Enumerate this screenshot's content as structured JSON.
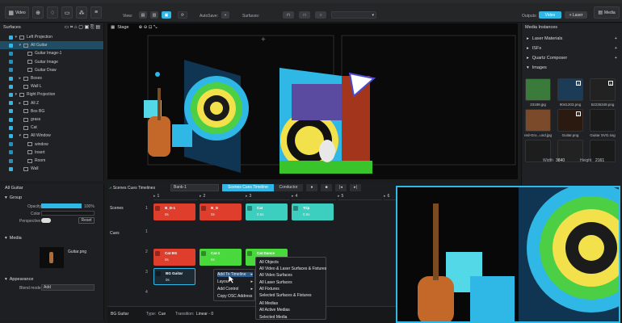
{
  "toolbar": {
    "video_label": "Video",
    "view_label": "View:",
    "autosave_label": "AutoSave:",
    "surfaces_label": "Surfaces:",
    "outputs_label": "Outputs:",
    "output_video": "Video",
    "output_laser": "+ Laser",
    "media_label": "Media"
  },
  "left": {
    "surfaces_title": "Surfaces",
    "items": [
      {
        "label": "Left Projection",
        "indent": 1,
        "arrow": "▾",
        "sel": false
      },
      {
        "label": "All Guitar",
        "indent": 2,
        "arrow": "▾",
        "sel": true
      },
      {
        "label": "Guitar Image-1",
        "indent": 3,
        "arrow": "",
        "sel": false
      },
      {
        "label": "Guitar Image",
        "indent": 3,
        "arrow": "",
        "sel": false
      },
      {
        "label": "Guitar Draw",
        "indent": 3,
        "arrow": "",
        "sel": false
      },
      {
        "label": "Boxes",
        "indent": 2,
        "arrow": "▸",
        "sel": false
      },
      {
        "label": "Wall L",
        "indent": 2,
        "arrow": "",
        "sel": false
      },
      {
        "label": "Right Projection",
        "indent": 1,
        "arrow": "▾",
        "sel": false
      },
      {
        "label": "All Z",
        "indent": 2,
        "arrow": "▸",
        "sel": false
      },
      {
        "label": "Box BG",
        "indent": 2,
        "arrow": "",
        "sel": false
      },
      {
        "label": "grass",
        "indent": 2,
        "arrow": "",
        "sel": false
      },
      {
        "label": "Cat",
        "indent": 2,
        "arrow": "",
        "sel": false
      },
      {
        "label": "All Window",
        "indent": 2,
        "arrow": "▾",
        "sel": false
      },
      {
        "label": "window",
        "indent": 3,
        "arrow": "",
        "sel": false
      },
      {
        "label": "Insert",
        "indent": 3,
        "arrow": "",
        "sel": false
      },
      {
        "label": "Room",
        "indent": 3,
        "arrow": "",
        "sel": false
      },
      {
        "label": "Wall",
        "indent": 2,
        "arrow": "",
        "sel": false
      }
    ],
    "inspector_title": "All Guitar",
    "group_label": "Group",
    "opacity_label": "Opacity",
    "opacity_value": "100%",
    "opacity": 1.0,
    "color_label": "Color",
    "perspective_label": "Perspective",
    "reset_label": "Reset",
    "media_label": "Media",
    "media_file": "Guitar.png",
    "appearance_label": "Appearance",
    "blend_label": "Blend mode",
    "blend_value": "Add"
  },
  "stage": {
    "title": "Stage"
  },
  "mediapanel": {
    "title": "Media Instances",
    "sections": [
      "Laser Materials",
      "ISFs",
      "Quartz Composer",
      "Images"
    ],
    "tiles": [
      {
        "label": "33189.jpg",
        "badge": "",
        "bg": "#3a7a3a"
      },
      {
        "label": "9041203.png",
        "badge": "1",
        "bg": "#1c3b57"
      },
      {
        "label": "52235349.png",
        "badge": "1",
        "bg": "#222"
      },
      {
        "label": "red-Gro...und.jpg",
        "badge": "",
        "bg": "#7a4a2a"
      },
      {
        "label": "Guitar.png",
        "badge": "1",
        "bg": "#2a1a10"
      },
      {
        "label": "Guitar SVG.svg",
        "badge": "",
        "bg": "#1a1a1a"
      },
      {
        "label": "",
        "badge": "",
        "bg": "#1d1d1d"
      },
      {
        "label": "",
        "badge": "",
        "bg": "#222"
      },
      {
        "label": "",
        "badge": "",
        "bg": "#1a1a1a"
      }
    ],
    "width_label": "Width",
    "width_value": "3840",
    "height_label": "Height",
    "height_value": "2161"
  },
  "cues": {
    "tab_label": "Scenes Cues Timelines",
    "bank": "Bank-1",
    "seg_active": "Scenes Cues Timeline",
    "seg_other": "Conductor",
    "col_numbers": [
      "1",
      "2",
      "3",
      "4",
      "5",
      "6"
    ],
    "scenes_label": "Scenes",
    "scene_row_num": "1",
    "cues_label": "Cues",
    "cue_rows": [
      "1",
      "2",
      "3",
      "4"
    ],
    "scene_cards": [
      {
        "name": "B_D-1",
        "sub": "0s",
        "color": "#e03e2d"
      },
      {
        "name": "B_D",
        "sub": "0s",
        "color": "#e03e2d"
      },
      {
        "name": "Cat",
        "sub": "0.5s",
        "color": "#3ccfbf"
      },
      {
        "name": "Trip",
        "sub": "0.5s",
        "color": "#3ccfbf"
      }
    ],
    "cue_cards": [
      {
        "name": "Cat BG",
        "sub": "0s",
        "color": "#e03e2d"
      },
      {
        "name": "Cat-1",
        "sub": "0s",
        "color": "#49d93c"
      },
      {
        "name": "Cat Dance",
        "sub": "0s",
        "color": "#49d93c"
      },
      {
        "name": "BG Guitar",
        "sub": "0s",
        "color": "#1e2a33"
      }
    ],
    "footer_name": "BG Guitar",
    "footer_type_label": "Type:",
    "footer_type": "Cue",
    "footer_trans_label": "Transition:",
    "footer_trans": "Linear - 0"
  },
  "context_menu": {
    "items": [
      "Add To Timeline",
      "Layout",
      "Add Control",
      "Copy OSC Address"
    ]
  },
  "submenu": {
    "items": [
      "All Objects",
      "All Video & Laser Surfaces & Fixtures",
      "All Video Surfaces",
      "All Laser Surfaces",
      "All Fixtures",
      "Selected Surfaces & Fixtures",
      "All Medias",
      "All Active Medias",
      "Selected Media"
    ]
  }
}
